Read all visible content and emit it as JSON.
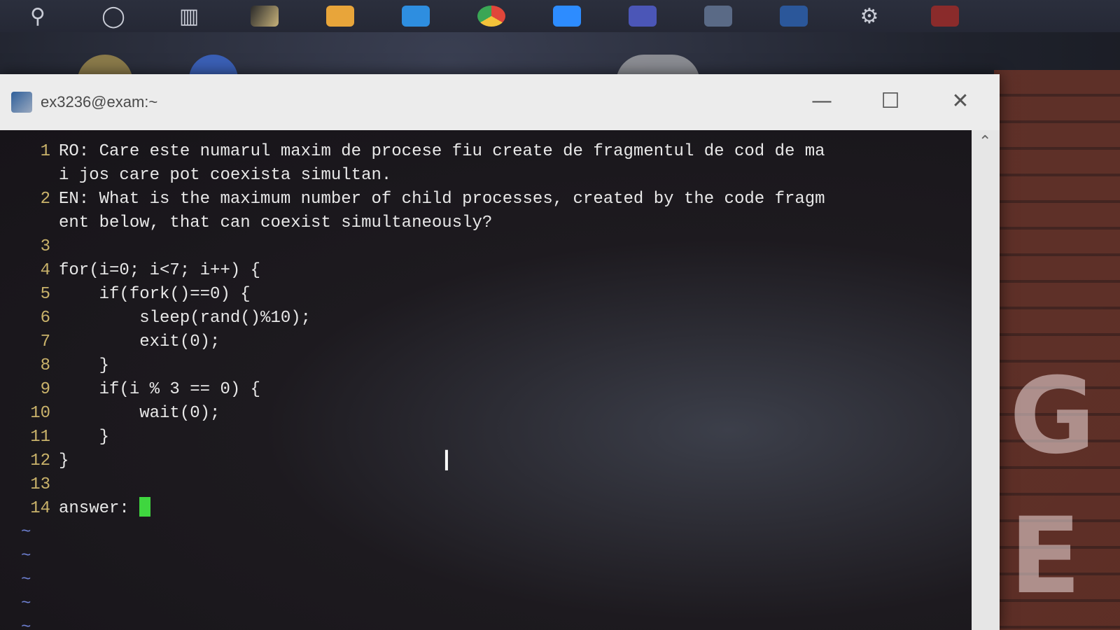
{
  "taskbar": {
    "icons": [
      "search-icon",
      "cortana-icon",
      "task-view-icon",
      "app-icon",
      "file-explorer-icon",
      "outlook-icon",
      "chrome-icon",
      "zoom-icon",
      "teams-icon",
      "network-icon",
      "word-icon",
      "settings-icon",
      "app-icon-2"
    ]
  },
  "window": {
    "title": "ex3236@exam:~",
    "minimize_glyph": "—",
    "maximize_glyph": "☐",
    "close_glyph": "✕"
  },
  "terminal": {
    "lines": [
      {
        "n": "1",
        "text": "RO: Care este numarul maxim de procese fiu create de fragmentul de cod de ma"
      },
      {
        "n": "",
        "text": "i jos care pot coexista simultan."
      },
      {
        "n": "2",
        "text": "EN: What is the maximum number of child processes, created by the code fragm"
      },
      {
        "n": "",
        "text": "ent below, that can coexist simultaneously?"
      },
      {
        "n": "3",
        "text": ""
      },
      {
        "n": "4",
        "text": "for(i=0; i<7; i++) {"
      },
      {
        "n": "5",
        "text": "    if(fork()==0) {"
      },
      {
        "n": "6",
        "text": "        sleep(rand()%10);"
      },
      {
        "n": "7",
        "text": "        exit(0);"
      },
      {
        "n": "8",
        "text": "    }"
      },
      {
        "n": "9",
        "text": "    if(i % 3 == 0) {"
      },
      {
        "n": "10",
        "text": "        wait(0);"
      },
      {
        "n": "11",
        "text": "    }"
      },
      {
        "n": "12",
        "text": "}"
      },
      {
        "n": "13",
        "text": ""
      },
      {
        "n": "14",
        "text": "answer: "
      }
    ],
    "tildes": [
      "~",
      "~",
      "~",
      "~",
      "~"
    ]
  },
  "colors": {
    "cursor": "#3fd63f",
    "line_numbers": "#c9b26a",
    "tilde": "#6d7fd0"
  }
}
